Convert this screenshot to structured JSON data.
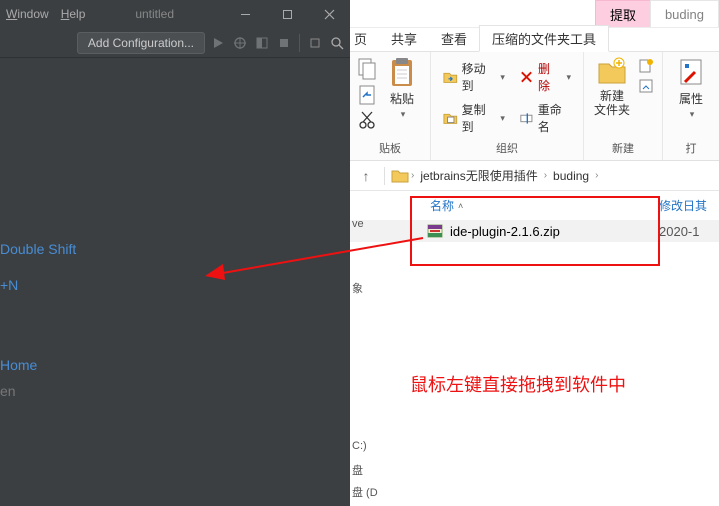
{
  "ide": {
    "menu": {
      "window": "Window",
      "help": "Help"
    },
    "title": "untitled",
    "add_config": "Add Configuration...",
    "welcome": {
      "double_shift": "Double Shift",
      "ctrl_n": "+N",
      "home": "Home",
      "en": "en"
    }
  },
  "explorer": {
    "outer_tabs": {
      "extract": "提取",
      "buding": "buding"
    },
    "ribbon_tabs": {
      "page_trunc": "页",
      "share": "共享",
      "view": "查看",
      "zip_tools": "压缩的文件夹工具"
    },
    "ribbon": {
      "clipboard": {
        "label": "贴板",
        "paste": "粘贴"
      },
      "organize": {
        "label": "组织",
        "move_to": "移动到",
        "delete": "删除",
        "copy_to": "复制到",
        "rename": "重命名"
      },
      "new": {
        "label": "新建",
        "new_folder": "新建\n文件夹"
      },
      "open_col": {
        "label": "打",
        "properties": "属性"
      }
    },
    "breadcrumb": {
      "folder": "jetbrains无限使用插件",
      "sub": "buding"
    },
    "columns": {
      "name": "名称",
      "modified": "修改日其"
    },
    "files": [
      {
        "name": "ide-plugin-2.1.6.zip",
        "date": "2020-1"
      }
    ],
    "annotation": "鼠标左键直接拖拽到软件中"
  },
  "peek": {
    "ve": "ve",
    "xiang": "象",
    "c": "C:)",
    "pan": "盘",
    "pan_d": "盘 (D"
  }
}
